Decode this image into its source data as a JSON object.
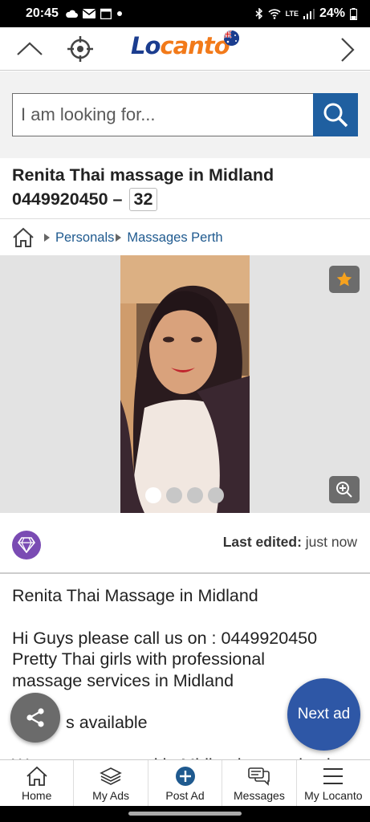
{
  "status_bar": {
    "time": "20:45",
    "network": "LTE",
    "battery": "24%"
  },
  "header": {
    "logo_lo": "Lo",
    "logo_canto": "canto"
  },
  "search": {
    "placeholder": "I am looking for..."
  },
  "listing": {
    "title_line1": "Renita Thai massage in Midland",
    "title_line2": "0449920450 –",
    "id_badge": "32"
  },
  "breadcrumb": {
    "items": [
      "Personals",
      "Massages Perth"
    ]
  },
  "gallery": {
    "image_count": 4,
    "active_index": 0
  },
  "meta": {
    "last_edited_label": "Last edited:",
    "last_edited_value": "just now"
  },
  "description": {
    "line1": "Renita Thai Massage in Midland",
    "line2": "Hi Guys please call us on : 0449920450",
    "line3": "Pretty Thai girls with professional",
    "line4": "massage services in Midland",
    "line5": "s available",
    "line6": "W                    ated in Midland    n      ite the"
  },
  "fab": {
    "next_label": "Next ad"
  },
  "bottom_nav": {
    "items": [
      "Home",
      "My Ads",
      "Post Ad",
      "Messages",
      "My Locanto"
    ]
  },
  "colors": {
    "brand_blue": "#1b3d8f",
    "brand_orange": "#f27a1a",
    "link_blue": "#1f5a8f",
    "premium_purple": "#7a4bb3",
    "fab_blue": "#2e57a6"
  }
}
